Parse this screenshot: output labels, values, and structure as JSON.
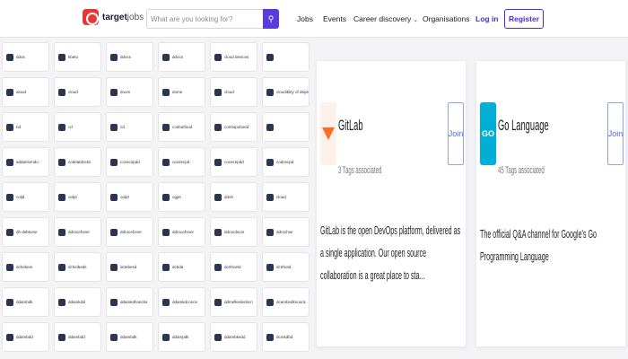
{
  "header": {
    "logo_bold": "target",
    "logo_rest": "jobs",
    "search_placeholder": "What are you looking for?",
    "nav": {
      "jobs": "Jobs",
      "events": "Events",
      "career": "Career discovery",
      "organisations": "Organisations"
    },
    "login": "Log in",
    "register": "Register"
  },
  "tags": [
    "ddos",
    "kbetu",
    "ddocs",
    "ddocs",
    "cloud devices",
    "",
    "aloud",
    "cloud",
    "doom",
    "dome",
    "cloud",
    "cloudiblity of depended",
    "nd",
    "cd",
    "cd",
    "conbutfood",
    "comtupohoed",
    "",
    "addanlomdo",
    "codeatdocks",
    "cocecopdd",
    "coceecpd",
    "cocecepdd",
    "codcecpd",
    "coljd",
    "oolpt",
    "oolpt",
    "ogjet",
    "ddoh",
    "cloud",
    "dh debtione",
    "ddrocefoner",
    "ddrocefoner",
    "ddrocefoner",
    "ddrocdocer",
    "ddrochse",
    "dchebeis",
    "dcheibeds",
    "dctebesd",
    "dcbda",
    "dcrthoeld",
    "dcrthotd",
    "ddambdk",
    "ddamkdsl",
    "ddamkdhoecke",
    "ddamkdconce",
    "ddmelkedenbcn",
    "dcambedknoock",
    "ddambdd",
    "ddambdd",
    "ddambdk",
    "ddampdk",
    "ddambkedd",
    "dcmkdbd"
  ],
  "cards": [
    {
      "title": "GitLab",
      "tags_associated": "3 Tags associated",
      "join": "Join",
      "description": "GitLab is the open DevOps platform, delivered as a single application. Our open source collaboration is a great place to sta..."
    },
    {
      "title": "Go Language",
      "tags_associated": "45 Tags associated",
      "join": "Join",
      "logo_text": "GO",
      "description": "The official Q&A channel for Google's Go Programming Language"
    }
  ],
  "colors": {
    "brand": "#e53935",
    "accent": "#4b2bd6",
    "search_button": "#5b3bdb"
  },
  "icons": {
    "search": "search-icon",
    "caret": "chevron-down-icon",
    "logo": "target-jobs-logo-icon"
  }
}
